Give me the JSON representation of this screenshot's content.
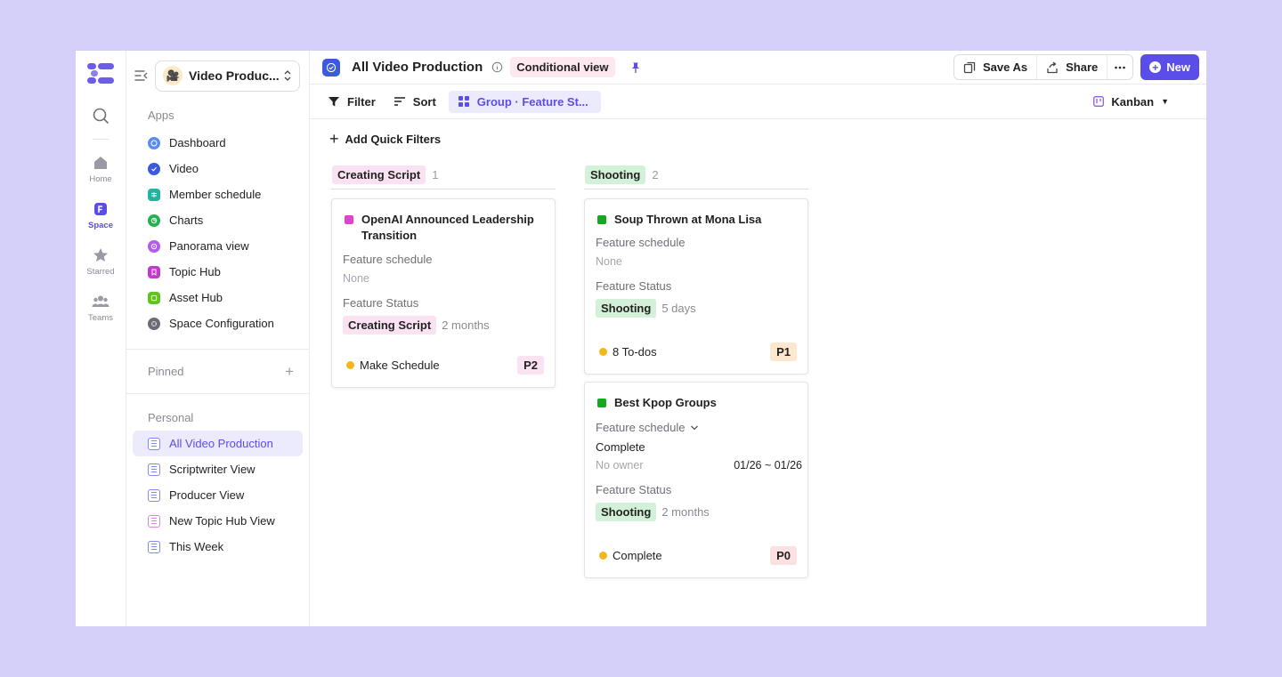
{
  "rail": {
    "items": [
      {
        "label": "Home"
      },
      {
        "label": "Space"
      },
      {
        "label": "Starred"
      },
      {
        "label": "Teams"
      }
    ]
  },
  "sidebar": {
    "space_name": "Video Produc...",
    "apps_title": "Apps",
    "apps": [
      {
        "label": "Dashboard",
        "color": "#5b8def"
      },
      {
        "label": "Video",
        "color": "#3b5bdb"
      },
      {
        "label": "Member schedule",
        "color": "#1fb5a0"
      },
      {
        "label": "Charts",
        "color": "#22b14c"
      },
      {
        "label": "Panorama view",
        "color": "#b15bf0"
      },
      {
        "label": "Topic Hub",
        "color": "#c13ac9"
      },
      {
        "label": "Asset Hub",
        "color": "#5fc51b"
      },
      {
        "label": "Space Configuration",
        "color": "#6b6b74"
      }
    ],
    "pinned_title": "Pinned",
    "personal_title": "Personal",
    "personal": [
      {
        "label": "All Video Production"
      },
      {
        "label": "Scriptwriter View"
      },
      {
        "label": "Producer View"
      },
      {
        "label": "New Topic Hub View"
      },
      {
        "label": "This Week"
      }
    ]
  },
  "header": {
    "title": "All Video Production",
    "badge": "Conditional view",
    "save_as": "Save As",
    "share": "Share",
    "new": "New"
  },
  "toolbar": {
    "filter": "Filter",
    "sort": "Sort",
    "group": "Group · Feature St...",
    "view": "Kanban",
    "quick_filters": "Add Quick Filters"
  },
  "colors": {
    "accent": "#5b4ee8",
    "creating_script_tag": "#fbe2f3",
    "shooting_tag": "#d3f0d9",
    "p2": "#fbe2f3",
    "p1": "#fde7cf",
    "p0": "#fde0e0"
  },
  "board": {
    "columns": [
      {
        "title": "Creating Script",
        "count": "1",
        "cards": [
          {
            "title": "OpenAI Announced Leadership Transition",
            "schedule_label": "Feature schedule",
            "schedule_value": "None",
            "status_label": "Feature Status",
            "status": "Creating Script",
            "since": "2 months",
            "footer": "Make Schedule",
            "priority": "P2"
          }
        ]
      },
      {
        "title": "Shooting",
        "count": "2",
        "cards": [
          {
            "title": "Soup Thrown at Mona Lisa",
            "schedule_label": "Feature schedule",
            "schedule_value": "None",
            "status_label": "Feature Status",
            "status": "Shooting",
            "since": "5 days",
            "footer": "8 To-dos",
            "priority": "P1"
          },
          {
            "title": "Best Kpop Groups",
            "schedule_label": "Feature schedule",
            "schedule_state": "Complete",
            "schedule_owner": "No owner",
            "schedule_dates": "01/26 ~ 01/26",
            "status_label": "Feature Status",
            "status": "Shooting",
            "since": "2 months",
            "footer": "Complete",
            "priority": "P0"
          }
        ]
      }
    ]
  }
}
